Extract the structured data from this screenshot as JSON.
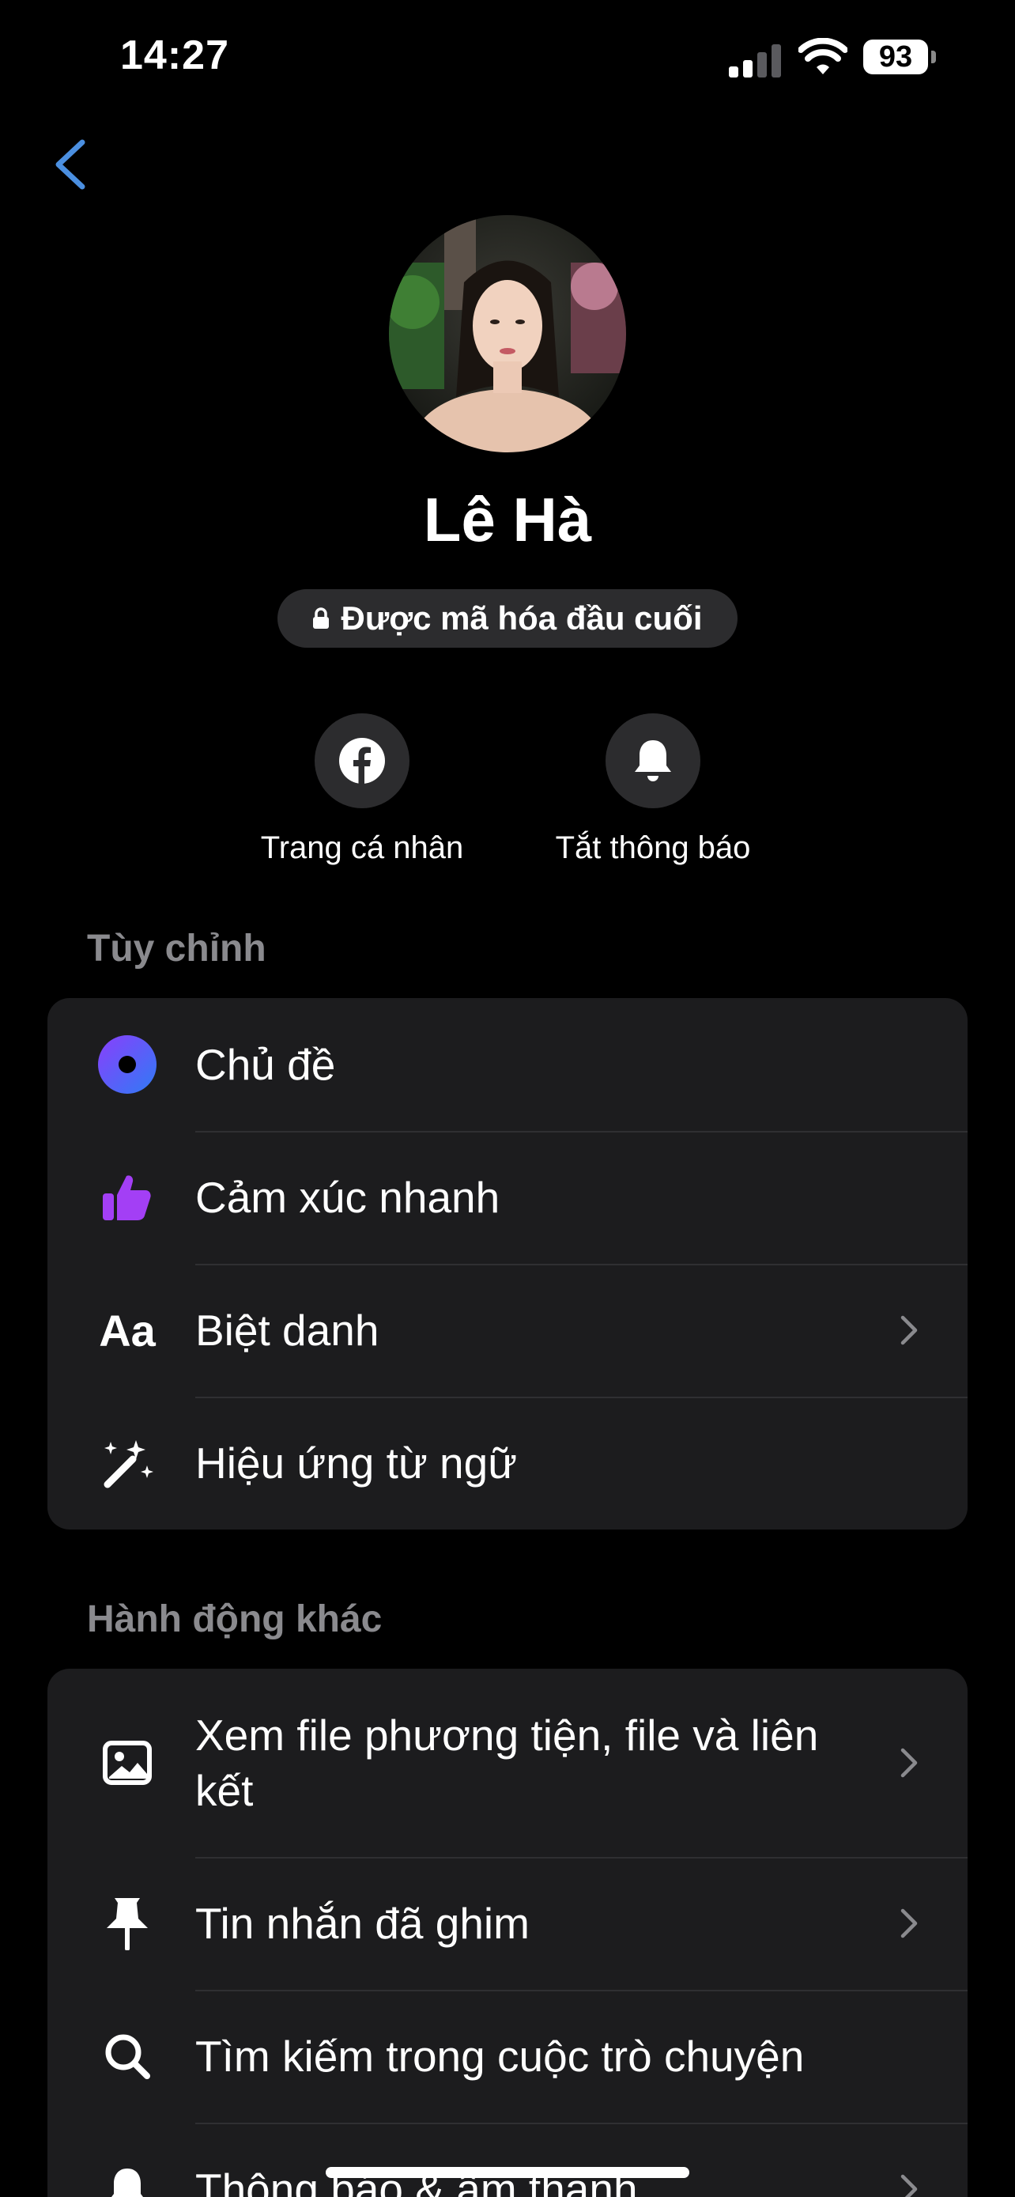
{
  "status_bar": {
    "time": "14:27",
    "battery": "93",
    "icons": [
      "signal-icon",
      "wifi-icon",
      "battery-icon"
    ]
  },
  "header": {
    "back_icon": "chevron-left-icon"
  },
  "profile": {
    "name": "Lê Hà",
    "encryption_label": "Được mã hóa đầu cuối"
  },
  "actions": [
    {
      "label": "Trang cá nhân",
      "icon": "facebook-icon"
    },
    {
      "label": "Tắt thông báo",
      "icon": "bell-icon"
    }
  ],
  "customize": {
    "title": "Tùy chỉnh",
    "items": [
      {
        "label": "Chủ đề",
        "icon": "theme-icon"
      },
      {
        "label": "Cảm xúc nhanh",
        "icon": "thumbs-up-icon"
      },
      {
        "label": "Biệt danh",
        "icon": "nickname-icon",
        "icon_text": "Aa"
      },
      {
        "label": "Hiệu ứng từ ngữ",
        "icon": "magic-wand-icon"
      }
    ]
  },
  "other_actions": {
    "title": "Hành động khác",
    "items": [
      {
        "label": "Xem file phương tiện, file và liên kết",
        "icon": "image-icon"
      },
      {
        "label": "Tin nhắn đã ghim",
        "icon": "pin-icon"
      },
      {
        "label": "Tìm kiếm trong cuộc trò chuyện",
        "icon": "search-icon"
      },
      {
        "label": "Thông báo & âm thanh",
        "icon": "bell-icon"
      }
    ]
  },
  "colors": {
    "background": "#000000",
    "card": "#1c1c1e",
    "accent_blue": "#4b8fe0",
    "theme_gradient_start": "#8a3ffc",
    "theme_gradient_end": "#2f7bf5",
    "thumbs_purple": "#a33ff5"
  }
}
